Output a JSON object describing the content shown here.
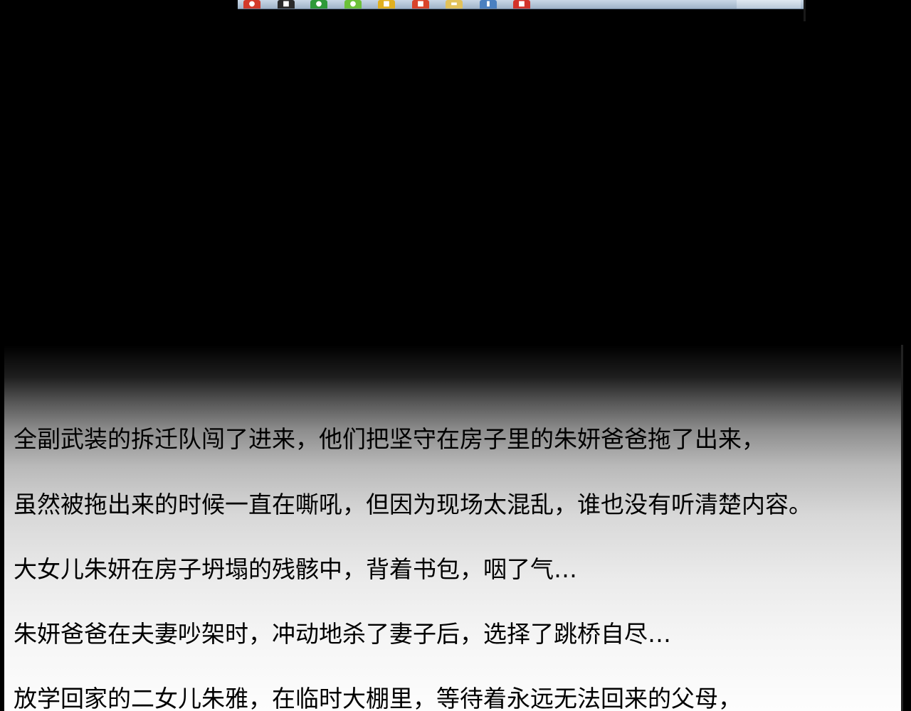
{
  "taskbar_icons": [
    {
      "name": "browser-icon",
      "color": "#d23a2a"
    },
    {
      "name": "media-icon",
      "color": "#2a2a2a"
    },
    {
      "name": "chat-icon",
      "color": "#2e9a3a"
    },
    {
      "name": "player-icon",
      "color": "#6cc13a"
    },
    {
      "name": "app-icon",
      "color": "#e0b020"
    },
    {
      "name": "html5-icon",
      "color": "#d9432a"
    },
    {
      "name": "folder-icon",
      "color": "#e2c25a"
    },
    {
      "name": "document-icon",
      "color": "#4a80c0"
    },
    {
      "name": "store-icon",
      "color": "#d2332a"
    }
  ],
  "narration": {
    "line1": "全副武装的拆迁队闯了进来，他们把坚守在房子里的朱妍爸爸拖了出来，",
    "line2": "虽然被拖出来的时候一直在嘶吼，但因为现场太混乱，谁也没有听清楚内容。",
    "line3": "大女儿朱妍在房子坍塌的残骸中，背着书包，咽了气…",
    "line4": "朱妍爸爸在夫妻吵架时，冲动地杀了妻子后，选择了跳桥自尽…",
    "line5": "放学回家的二女儿朱雅，在临时大棚里，等待着永远无法回来的父母，"
  }
}
